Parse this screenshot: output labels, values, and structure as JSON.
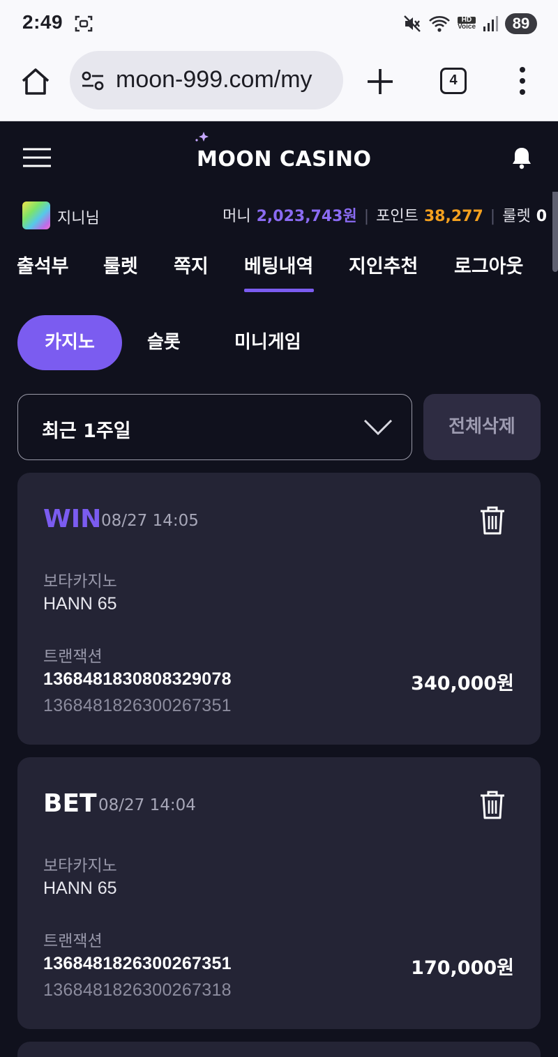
{
  "status_bar": {
    "time": "2:49",
    "battery": "89",
    "hd_label": "HD",
    "voice_label": "Voice"
  },
  "browser": {
    "url": "moon-999.com/my",
    "tab_count": "4"
  },
  "header": {
    "logo_moon": "MOON",
    "logo_casino": "CASINO"
  },
  "user": {
    "name": "지니님",
    "money_label": "머니",
    "money_value": "2,023,743원",
    "point_label": "포인트",
    "point_value": "38,277",
    "roulette_label": "룰렛",
    "roulette_value": "0"
  },
  "nav": {
    "items": [
      "출석부",
      "룰렛",
      "쪽지",
      "베팅내역",
      "지인추천",
      "로그아웃"
    ],
    "active": "베팅내역"
  },
  "sub_tabs": {
    "items": [
      "카지노",
      "슬롯",
      "미니게임"
    ],
    "active": "카지노"
  },
  "filter": {
    "period": "최근 1주일",
    "delete_all": "전체삭제"
  },
  "records": [
    {
      "status": "WIN",
      "datetime": "08/27 14:05",
      "provider": "보타카지노",
      "game": "HANN 65",
      "tx_label": "트랜잭션",
      "tx_main": "1368481830808329078",
      "tx_sub": "1368481826300267351",
      "amount": "340,000원"
    },
    {
      "status": "BET",
      "datetime": "08/27 14:04",
      "provider": "보타카지노",
      "game": "HANN 65",
      "tx_label": "트랜잭션",
      "tx_main": "1368481826300267351",
      "tx_sub": "1368481826300267318",
      "amount": "170,000원"
    }
  ],
  "colors": {
    "accent": "#7b5cf0",
    "point": "#f3a01f",
    "background": "#10111d",
    "card": "#242435"
  }
}
